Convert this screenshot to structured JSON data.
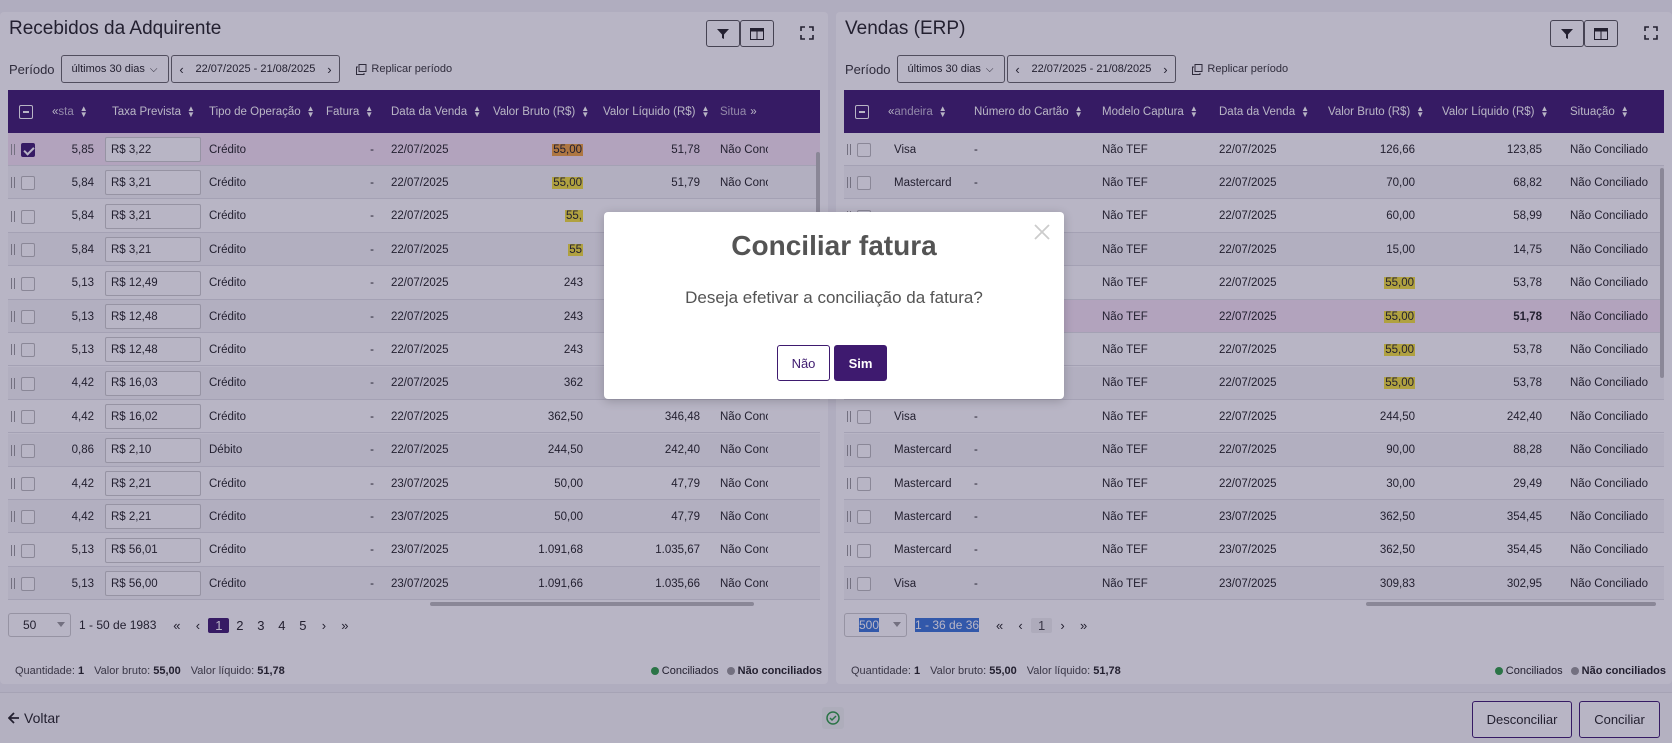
{
  "left": {
    "title": "Recebidos da Adquirente",
    "period_label": "Período",
    "period_select": "últimos 30 dias",
    "date_range": "22/07/2025 - 21/08/2025",
    "replicar": "Replicar período",
    "columns": [
      "sta",
      "Taxa Prevista",
      "Tipo de Operação",
      "Fatura",
      "Data da Venda",
      "Valor Bruto (R$)",
      "Valor Líquido (R$)",
      "Situa"
    ],
    "rows": [
      {
        "pct": "5,85",
        "taxa": "R$ 3,22",
        "tipo": "Crédito",
        "fatura": "-",
        "data": "22/07/2025",
        "bruto": "55,00",
        "liquido": "51,78",
        "sit": "Não Conci"
      },
      {
        "pct": "5,84",
        "taxa": "R$ 3,21",
        "tipo": "Crédito",
        "fatura": "-",
        "data": "22/07/2025",
        "bruto": "55,00",
        "liquido": "51,79",
        "sit": "Não Conci"
      },
      {
        "pct": "5,84",
        "taxa": "R$ 3,21",
        "tipo": "Crédito",
        "fatura": "-",
        "data": "22/07/2025",
        "bruto": "55,",
        "liquido": "",
        "sit": ""
      },
      {
        "pct": "5,84",
        "taxa": "R$ 3,21",
        "tipo": "Crédito",
        "fatura": "-",
        "data": "22/07/2025",
        "bruto": "55",
        "liquido": "",
        "sit": ""
      },
      {
        "pct": "5,13",
        "taxa": "R$ 12,49",
        "tipo": "Crédito",
        "fatura": "-",
        "data": "22/07/2025",
        "bruto": "243",
        "liquido": "",
        "sit": ""
      },
      {
        "pct": "5,13",
        "taxa": "R$ 12,48",
        "tipo": "Crédito",
        "fatura": "-",
        "data": "22/07/2025",
        "bruto": "243",
        "liquido": "",
        "sit": ""
      },
      {
        "pct": "5,13",
        "taxa": "R$ 12,48",
        "tipo": "Crédito",
        "fatura": "-",
        "data": "22/07/2025",
        "bruto": "243",
        "liquido": "",
        "sit": ""
      },
      {
        "pct": "4,42",
        "taxa": "R$ 16,03",
        "tipo": "Crédito",
        "fatura": "-",
        "data": "22/07/2025",
        "bruto": "362",
        "liquido": "",
        "sit": ""
      },
      {
        "pct": "4,42",
        "taxa": "R$ 16,02",
        "tipo": "Crédito",
        "fatura": "-",
        "data": "22/07/2025",
        "bruto": "362,50",
        "liquido": "346,48",
        "sit": "Não Conci"
      },
      {
        "pct": "0,86",
        "taxa": "R$ 2,10",
        "tipo": "Débito",
        "fatura": "-",
        "data": "22/07/2025",
        "bruto": "244,50",
        "liquido": "242,40",
        "sit": "Não Conci"
      },
      {
        "pct": "4,42",
        "taxa": "R$ 2,21",
        "tipo": "Crédito",
        "fatura": "-",
        "data": "23/07/2025",
        "bruto": "50,00",
        "liquido": "47,79",
        "sit": "Não Conci"
      },
      {
        "pct": "4,42",
        "taxa": "R$ 2,21",
        "tipo": "Crédito",
        "fatura": "-",
        "data": "23/07/2025",
        "bruto": "50,00",
        "liquido": "47,79",
        "sit": "Não Conci"
      },
      {
        "pct": "5,13",
        "taxa": "R$ 56,01",
        "tipo": "Crédito",
        "fatura": "-",
        "data": "23/07/2025",
        "bruto": "1.091,68",
        "liquido": "1.035,67",
        "sit": "Não Conci"
      },
      {
        "pct": "5,13",
        "taxa": "R$ 56,00",
        "tipo": "Crédito",
        "fatura": "-",
        "data": "23/07/2025",
        "bruto": "1.091,66",
        "liquido": "1.035,66",
        "sit": "Não Conci"
      }
    ],
    "page_size": "50",
    "range_text": "1 - 50 de 1983",
    "pages": [
      "«",
      "‹",
      "1",
      "2",
      "3",
      "4",
      "5",
      "›",
      "»"
    ],
    "stats": {
      "qtd_label": "Quantidade:",
      "qtd": "1",
      "bruto_label": "Valor bruto:",
      "bruto": "55,00",
      "liq_label": "Valor líquido:",
      "liq": "51,78"
    },
    "legend": {
      "conciliados": "Conciliados",
      "nao_conciliados": "Não conciliados"
    }
  },
  "right": {
    "title": "Vendas (ERP)",
    "period_label": "Período",
    "period_select": "últimos 30 dias",
    "date_range": "22/07/2025 - 21/08/2025",
    "replicar": "Replicar período",
    "columns": [
      "andeira",
      "Número do Cartão",
      "Modelo Captura",
      "Data da Venda",
      "Valor Bruto (R$)",
      "Valor Líquido (R$)",
      "Situação"
    ],
    "rows": [
      {
        "band": "Visa",
        "cartao": "-",
        "modelo": "Não TEF",
        "data": "22/07/2025",
        "bruto": "126,66",
        "liquido": "123,85",
        "sit": "Não Conciliado"
      },
      {
        "band": "Mastercard",
        "cartao": "-",
        "modelo": "Não TEF",
        "data": "22/07/2025",
        "bruto": "70,00",
        "liquido": "68,82",
        "sit": "Não Conciliado"
      },
      {
        "band": "",
        "cartao": "",
        "modelo": "Não TEF",
        "data": "22/07/2025",
        "bruto": "60,00",
        "liquido": "58,99",
        "sit": "Não Conciliado"
      },
      {
        "band": "",
        "cartao": "",
        "modelo": "Não TEF",
        "data": "22/07/2025",
        "bruto": "15,00",
        "liquido": "14,75",
        "sit": "Não Conciliado"
      },
      {
        "band": "",
        "cartao": "",
        "modelo": "Não TEF",
        "data": "22/07/2025",
        "bruto": "55,00",
        "liquido": "53,78",
        "sit": "Não Conciliado"
      },
      {
        "band": "",
        "cartao": "",
        "modelo": "Não TEF",
        "data": "22/07/2025",
        "bruto": "55,00",
        "liquido": "51,78",
        "sit": "Não Conciliado"
      },
      {
        "band": "",
        "cartao": "",
        "modelo": "Não TEF",
        "data": "22/07/2025",
        "bruto": "55,00",
        "liquido": "53,78",
        "sit": "Não Conciliado"
      },
      {
        "band": "",
        "cartao": "",
        "modelo": "Não TEF",
        "data": "22/07/2025",
        "bruto": "55,00",
        "liquido": "53,78",
        "sit": "Não Conciliado"
      },
      {
        "band": "Visa",
        "cartao": "-",
        "modelo": "Não TEF",
        "data": "22/07/2025",
        "bruto": "244,50",
        "liquido": "242,40",
        "sit": "Não Conciliado"
      },
      {
        "band": "Mastercard",
        "cartao": "-",
        "modelo": "Não TEF",
        "data": "22/07/2025",
        "bruto": "90,00",
        "liquido": "88,28",
        "sit": "Não Conciliado"
      },
      {
        "band": "Mastercard",
        "cartao": "-",
        "modelo": "Não TEF",
        "data": "22/07/2025",
        "bruto": "30,00",
        "liquido": "29,49",
        "sit": "Não Conciliado"
      },
      {
        "band": "Mastercard",
        "cartao": "-",
        "modelo": "Não TEF",
        "data": "23/07/2025",
        "bruto": "362,50",
        "liquido": "354,45",
        "sit": "Não Conciliado"
      },
      {
        "band": "Mastercard",
        "cartao": "-",
        "modelo": "Não TEF",
        "data": "23/07/2025",
        "bruto": "362,50",
        "liquido": "354,45",
        "sit": "Não Conciliado"
      },
      {
        "band": "Visa",
        "cartao": "-",
        "modelo": "Não TEF",
        "data": "23/07/2025",
        "bruto": "309,83",
        "liquido": "302,95",
        "sit": "Não Conciliado"
      }
    ],
    "page_size": "500",
    "range_text": "1 - 36 de 36",
    "pages": [
      "«",
      "‹",
      "1",
      "›",
      "»"
    ],
    "stats": {
      "qtd_label": "Quantidade:",
      "qtd": "1",
      "bruto_label": "Valor bruto:",
      "bruto": "55,00",
      "liq_label": "Valor líquido:",
      "liq": "51,78"
    },
    "legend": {
      "conciliados": "Conciliados",
      "nao_conciliados": "Não conciliados"
    }
  },
  "bottom": {
    "voltar": "Voltar",
    "desconciliar": "Desconciliar",
    "conciliar": "Conciliar"
  },
  "modal": {
    "title": "Conciliar fatura",
    "text": "Deseja efetivar a conciliação da fatura?",
    "no": "Não",
    "yes": "Sim"
  },
  "colors": {
    "brand": "#3e1a6f",
    "highlight": "#f4e23a",
    "highlight_orange": "#f0a33d",
    "conciliado": "#2e9e44",
    "nao_conciliado": "#999999"
  },
  "icons": {
    "filter": "filter-icon",
    "columns": "columns-icon",
    "expand": "expand-icon",
    "copy": "copy-icon",
    "close": "close-icon",
    "check_circle": "check-circle-icon",
    "arrow_left": "arrow-left-icon"
  }
}
